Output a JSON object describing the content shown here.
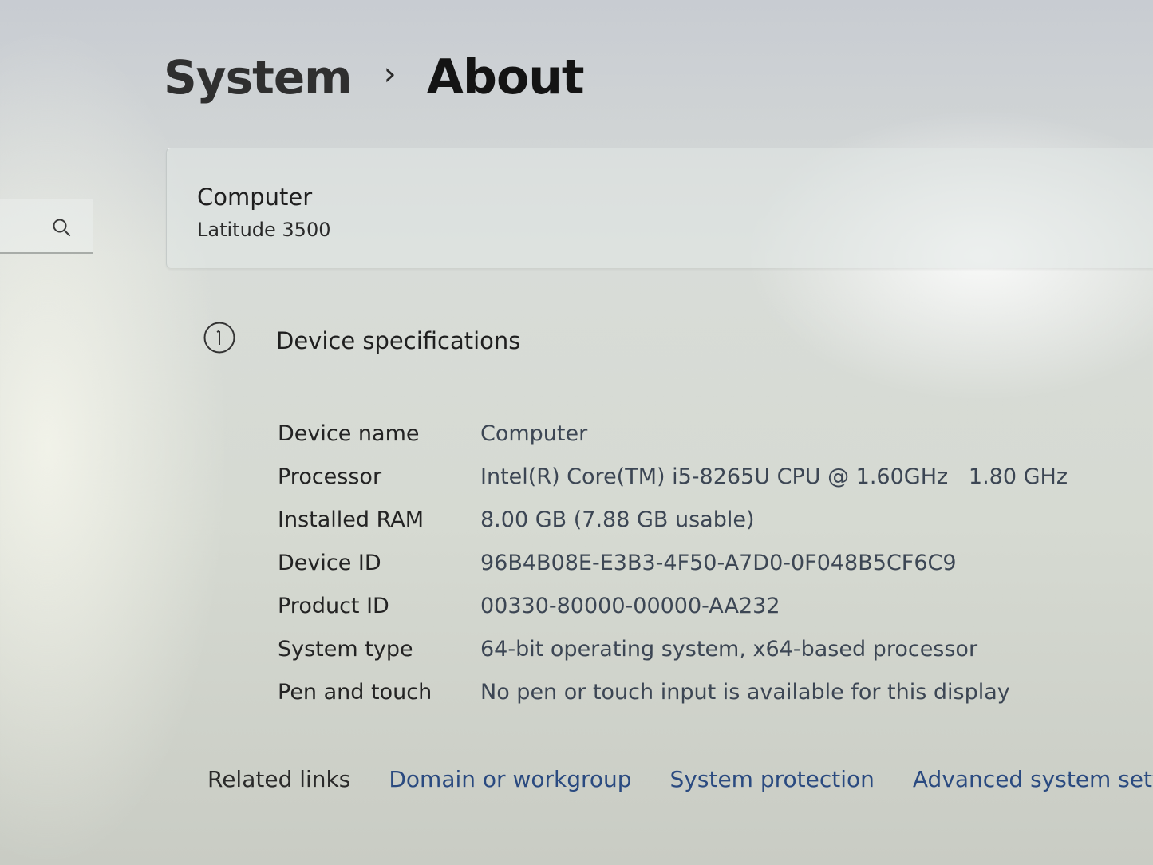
{
  "breadcrumb": {
    "parent": "System",
    "separator": "›",
    "current": "About"
  },
  "search": {
    "icon": "search-icon"
  },
  "computer_card": {
    "title": "Computer",
    "model": "Latitude 3500"
  },
  "device_specifications": {
    "title": "Device specifications",
    "icon": "info-icon",
    "rows": [
      {
        "label": "Device name",
        "value": "Computer"
      },
      {
        "label": "Processor",
        "value": "Intel(R) Core(TM) i5-8265U CPU @ 1.60GHz   1.80 GHz"
      },
      {
        "label": "Installed RAM",
        "value": "8.00 GB (7.88 GB usable)"
      },
      {
        "label": "Device ID",
        "value": "96B4B08E-E3B3-4F50-A7D0-0F048B5CF6C9"
      },
      {
        "label": "Product ID",
        "value": "00330-80000-00000-AA232"
      },
      {
        "label": "System type",
        "value": "64-bit operating system, x64-based processor"
      },
      {
        "label": "Pen and touch",
        "value": "No pen or touch input is available for this display"
      }
    ]
  },
  "related_links": {
    "label": "Related links",
    "links": [
      "Domain or workgroup",
      "System protection",
      "Advanced system settings"
    ]
  },
  "colors": {
    "link": "#2a4a80",
    "value_text": "#3c4654"
  }
}
